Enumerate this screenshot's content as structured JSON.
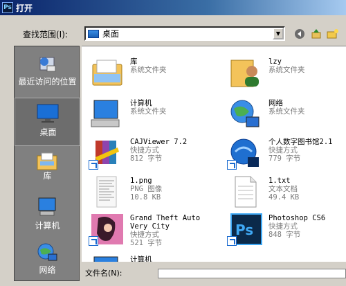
{
  "window": {
    "title": "打开",
    "app_badge": "Ps"
  },
  "lookin": {
    "label": "查找范围(I):",
    "value": "桌面"
  },
  "places": [
    {
      "label": "最近访问的位置"
    },
    {
      "label": "桌面"
    },
    {
      "label": "库"
    },
    {
      "label": "计算机"
    },
    {
      "label": "网络"
    }
  ],
  "files": [
    {
      "name": "库",
      "line2": "系统文件夹",
      "line3": "",
      "icon": "library-folder-icon"
    },
    {
      "name": "lzy",
      "line2": "系统文件夹",
      "line3": "",
      "icon": "user-folder-icon"
    },
    {
      "name": "计算机",
      "line2": "系统文件夹",
      "line3": "",
      "icon": "computer-icon"
    },
    {
      "name": "网络",
      "line2": "系统文件夹",
      "line3": "",
      "icon": "network-icon"
    },
    {
      "name": "CAJViewer 7.2",
      "line2": "快捷方式",
      "line3": "812 字节",
      "icon": "cajviewer-icon"
    },
    {
      "name": "个人数字图书馆2.1",
      "line2": "快捷方式",
      "line3": "779 字节",
      "icon": "digital-library-icon"
    },
    {
      "name": "1.png",
      "line2": "PNG 图像",
      "line3": "10.8 KB",
      "icon": "png-thumbnail-icon"
    },
    {
      "name": "1.txt",
      "line2": "文本文档",
      "line3": "49.4 KB",
      "icon": "text-document-icon"
    },
    {
      "name": "Grand Theft Auto",
      "line2": "Very City",
      "line3": "快捷方式",
      "line4": "521 字节",
      "icon": "gta-icon"
    },
    {
      "name": "Photoshop CS6",
      "line2": "快捷方式",
      "line3": "848 字节",
      "icon": "photoshop-icon"
    },
    {
      "name": "计算机",
      "line2": "",
      "line3": "",
      "icon": "computer-icon"
    }
  ],
  "filename": {
    "label": "文件名(N):",
    "value": ""
  }
}
